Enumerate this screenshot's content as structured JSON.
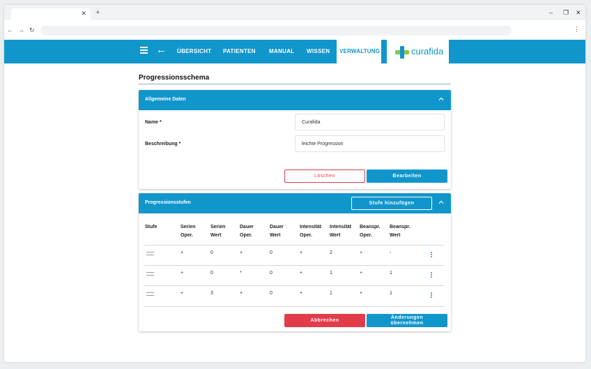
{
  "nav": {
    "links": [
      "ÜBERSICHT",
      "PATIENTEN",
      "MANUAL",
      "WISSEN"
    ],
    "active": "VERWALTUNG",
    "logo": "curafida"
  },
  "page": {
    "title": "Progressionsschema"
  },
  "general": {
    "title": "Allgemeine Daten",
    "name_label": "Name *",
    "name_value": "Curafida",
    "desc_label": "Beschreibung *",
    "desc_value": "leichte Progression",
    "delete_label": "Löschen",
    "edit_label": "Bearbeiten"
  },
  "levels": {
    "title": "Progressionsstufen",
    "add_label": "Stufe hinzufügen",
    "headers": [
      [
        "Stufe",
        ""
      ],
      [
        "Serien",
        "Oper."
      ],
      [
        "Serien",
        "Wert"
      ],
      [
        "Dauer",
        "Oper."
      ],
      [
        "Dauer",
        "Wert"
      ],
      [
        "Intensität",
        "Oper."
      ],
      [
        "Intensität",
        "Wert"
      ],
      [
        "Beanspr.",
        "Oper."
      ],
      [
        "Beanspr.",
        "Wert"
      ]
    ],
    "rows": [
      [
        "+",
        "0",
        "+",
        "0",
        "+",
        "2",
        "+",
        "-"
      ],
      [
        "+",
        "0",
        "*",
        "0",
        "+",
        "1",
        "+",
        "1"
      ],
      [
        "+",
        "3",
        "+",
        "0",
        "+",
        "1",
        "+",
        "1"
      ]
    ],
    "cancel_label": "Abbrechen",
    "apply_label_1": "Änderungen",
    "apply_label_2": "übernehmen"
  },
  "colors": {
    "primary": "#1196cc",
    "danger": "#e23b4a",
    "logo_green": "#8dc63f"
  },
  "icons": [
    "close-icon",
    "plus-icon",
    "back-icon",
    "forward-icon",
    "reload-icon",
    "menu-icon",
    "arrow-left-icon",
    "chevron-up-icon",
    "drag-handle-icon",
    "more-vert-icon"
  ]
}
